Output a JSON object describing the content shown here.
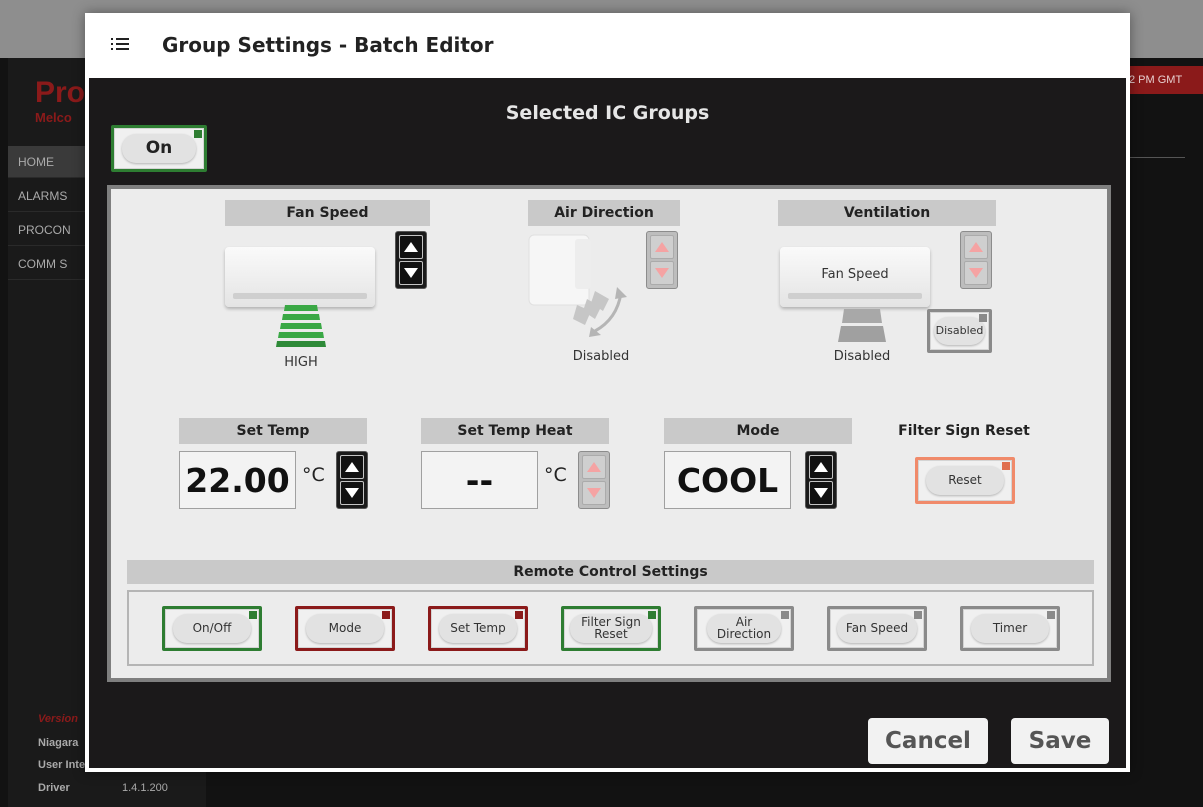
{
  "background": {
    "logo": "Pro",
    "logo_sub": "Melco",
    "clock": "2 PM GMT",
    "nav": [
      "HOME",
      "ALARMS",
      "PROCON",
      "COMM S"
    ],
    "footer": {
      "version_label": "Version",
      "rows": [
        {
          "label": "Niagara",
          "value": ""
        },
        {
          "label": "User Inte",
          "value": ""
        },
        {
          "label": "Driver",
          "value": "1.4.1.200"
        }
      ]
    }
  },
  "modal": {
    "title": "Group Settings - Batch Editor",
    "section_title": "Selected IC Groups",
    "power_button": {
      "label": "On",
      "state": "on",
      "color": "#2e7d32"
    },
    "fan_speed": {
      "label": "Fan Speed",
      "value": "HIGH"
    },
    "air_direction": {
      "label": "Air Direction",
      "value": "Disabled"
    },
    "ventilation": {
      "label": "Ventilation",
      "unit_text": "Fan Speed",
      "value": "Disabled",
      "button": "Disabled"
    },
    "set_temp": {
      "label": "Set Temp",
      "value": "22.00",
      "unit": "°C"
    },
    "set_temp_heat": {
      "label": "Set Temp Heat",
      "value": "--",
      "unit": "°C"
    },
    "mode": {
      "label": "Mode",
      "value": "COOL"
    },
    "filter_sign_reset": {
      "label": "Filter Sign Reset",
      "button": "Reset"
    },
    "remote_control": {
      "title": "Remote Control Settings",
      "buttons": [
        {
          "label": "On/Off",
          "state": "green"
        },
        {
          "label": "Mode",
          "state": "red"
        },
        {
          "label": "Set Temp",
          "state": "red"
        },
        {
          "label": "Filter Sign Reset",
          "state": "green"
        },
        {
          "label": "Air Direction",
          "state": "grey"
        },
        {
          "label": "Fan Speed",
          "state": "grey"
        },
        {
          "label": "Timer",
          "state": "grey"
        }
      ]
    },
    "cancel_label": "Cancel",
    "save_label": "Save"
  },
  "colors": {
    "enabled_green": "#2e7d32",
    "disabled_red": "#8b1a1a",
    "reset_orange": "#f08a6a",
    "fan_level_green": "#3aa845"
  }
}
